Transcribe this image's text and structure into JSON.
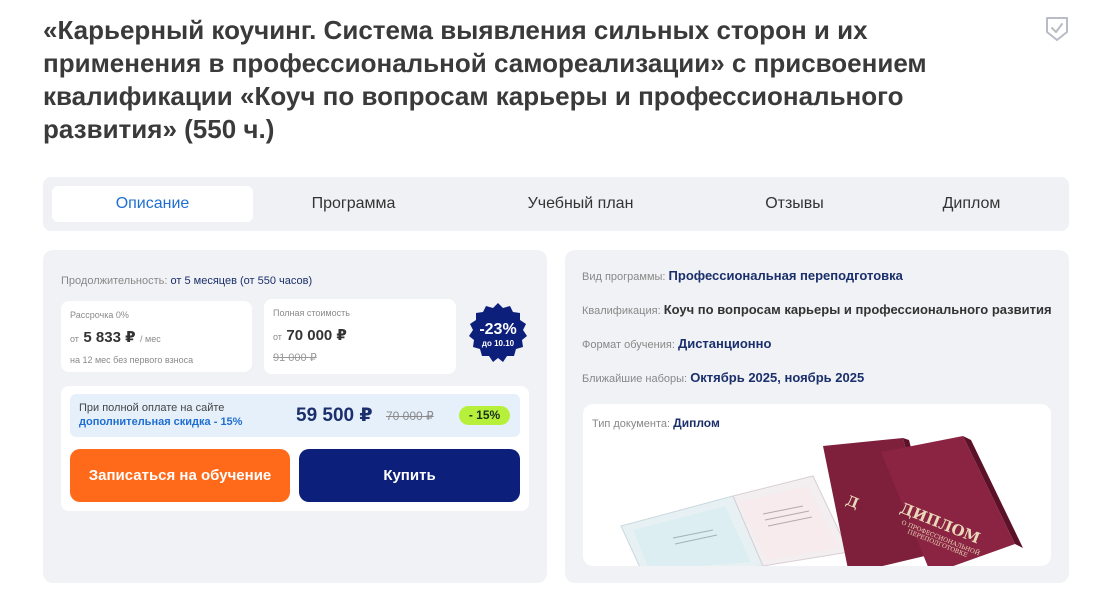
{
  "page": {
    "title": "«Карьерный коучинг. Система выявления сильных сторон и их применения в профессиональной самореализации» с присвоением квалификации «Коуч по вопросам карьеры и профессионального развития» (550 ч.)"
  },
  "icons": {
    "bookmark": "bookmark-shield-icon"
  },
  "tabs": [
    {
      "label": "Описание",
      "active": true
    },
    {
      "label": "Программа"
    },
    {
      "label": "Учебный план"
    },
    {
      "label": "Отзывы"
    },
    {
      "label": "Диплом"
    }
  ],
  "pricing": {
    "duration_label": "Продолжительность:",
    "duration_value": "от 5 месяцев (от 550 часов)",
    "installment": {
      "label": "Рассрочка 0%",
      "prefix": "от",
      "amount": "5 833 ₽",
      "per": "/ мес",
      "note": "на 12 мес без первого взноса"
    },
    "full": {
      "label": "Полная стоимость",
      "prefix": "от",
      "amount": "70 000 ₽",
      "old": "91 000 ₽"
    },
    "badge": {
      "percent": "-23%",
      "until": "до 10.10"
    },
    "promo": {
      "line1": "При полной оплате на сайте",
      "line2": "дополнительная скидка - 15%",
      "price": "59 500 ₽",
      "old": "70 000 ₽",
      "discount": "- 15%"
    },
    "buttons": {
      "enroll": "Записаться на обучение",
      "buy": "Купить"
    }
  },
  "info": {
    "program_type_label": "Вид программы:",
    "program_type": "Профессиональная переподготовка",
    "qualification_label": "Квалификация:",
    "qualification": "Коуч по вопросам карьеры и профессионального развития",
    "format_label": "Формат обучения:",
    "format": "Дистанционно",
    "intakes_label": "Ближайшие наборы:",
    "intakes": "Октябрь 2025, ноябрь 2025",
    "document_label": "Тип документа:",
    "document": "Диплом",
    "diploma_cover_text": "ДИПЛОМ",
    "diploma_cover_sub1": "О ПРОФЕССИОНАЛЬНОЙ",
    "diploma_cover_sub2": "ПЕРЕПОДГОТОВКЕ"
  },
  "colors": {
    "accent_blue": "#1f6fd1",
    "navy": "#0c1f7a",
    "orange": "#ff6a1a",
    "lime": "#b6f03a",
    "card_bg": "#f1f2f5"
  }
}
